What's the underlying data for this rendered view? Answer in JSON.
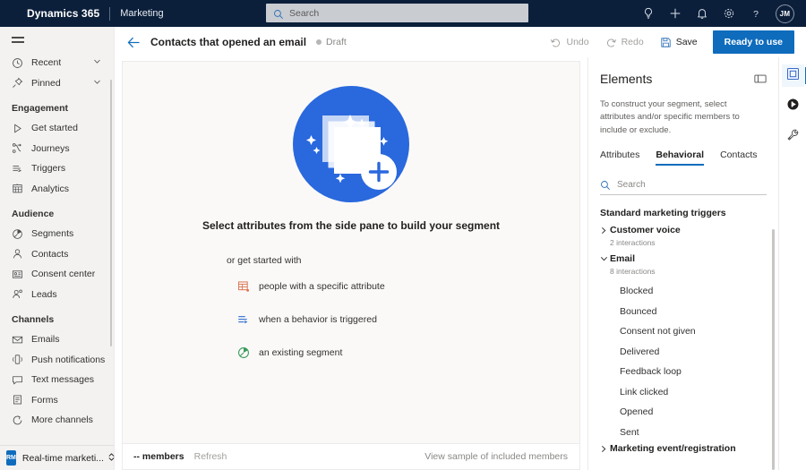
{
  "topnav": {
    "brand": "Dynamics 365",
    "app_name": "Marketing",
    "search_placeholder": "Search",
    "icons": [
      "lightbulb-icon",
      "plus-icon",
      "bell-icon",
      "gear-icon",
      "help-icon"
    ],
    "avatar_initials": "JM",
    "background": "#0b1f3b"
  },
  "sidebar": {
    "quick": [
      {
        "label": "Recent",
        "icon": "clock-icon",
        "expandable": true
      },
      {
        "label": "Pinned",
        "icon": "pin-icon",
        "expandable": true
      }
    ],
    "groups": [
      {
        "header": "Engagement",
        "items": [
          {
            "label": "Get started",
            "icon": "play-outline-icon"
          },
          {
            "label": "Journeys",
            "icon": "journeys-icon"
          },
          {
            "label": "Triggers",
            "icon": "triggers-icon"
          },
          {
            "label": "Analytics",
            "icon": "analytics-icon"
          }
        ]
      },
      {
        "header": "Audience",
        "items": [
          {
            "label": "Segments",
            "icon": "segments-icon"
          },
          {
            "label": "Contacts",
            "icon": "contact-icon"
          },
          {
            "label": "Consent center",
            "icon": "consent-icon"
          },
          {
            "label": "Leads",
            "icon": "leads-icon"
          }
        ]
      },
      {
        "header": "Channels",
        "items": [
          {
            "label": "Emails",
            "icon": "mail-icon"
          },
          {
            "label": "Push notifications",
            "icon": "push-icon"
          },
          {
            "label": "Text messages",
            "icon": "chat-icon"
          },
          {
            "label": "Forms",
            "icon": "form-icon"
          },
          {
            "label": "More channels",
            "icon": "more-channels-icon"
          }
        ]
      }
    ],
    "workspace": {
      "badge": "RM",
      "label": "Real-time marketi...",
      "badge_color": "#0f6cbd"
    }
  },
  "command_bar": {
    "back": "back-arrow-icon",
    "title": "Contacts that opened an email",
    "status": "Draft",
    "undo": "Undo",
    "redo": "Redo",
    "save": "Save",
    "primary": "Ready to use",
    "primary_color": "#0f6cbd"
  },
  "canvas": {
    "empty_title": "Select attributes from the side pane to build your segment",
    "empty_subtitle": "or get started with",
    "options": [
      {
        "label": "people with a specific attribute",
        "icon": "table-attribute-icon",
        "color": "#d9714e"
      },
      {
        "label": "when a behavior is triggered",
        "icon": "trigger-icon",
        "color": "#2f6fd0"
      },
      {
        "label": "an existing segment",
        "icon": "segment-icon",
        "color": "#3a9a5c"
      }
    ],
    "hero_icon": "stacked-cards-add-icon",
    "hero_color": "#2a68dd"
  },
  "footer": {
    "members_count": "--",
    "members_label": "members",
    "refresh": "Refresh",
    "sample_link": "View sample of included members"
  },
  "elements_panel": {
    "title": "Elements",
    "header_icon": "expand-panel-icon",
    "description": "To construct your segment, select attributes and/or specific members to include or exclude.",
    "tabs": [
      {
        "label": "Attributes",
        "active": false
      },
      {
        "label": "Behavioral",
        "active": true
      },
      {
        "label": "Contacts",
        "active": false
      }
    ],
    "search_placeholder": "Search",
    "group_header": "Standard marketing triggers",
    "nodes": [
      {
        "name": "Customer voice",
        "sub": "2 interactions",
        "expanded": false,
        "children": []
      },
      {
        "name": "Email",
        "sub": "8 interactions",
        "expanded": true,
        "children": [
          "Blocked",
          "Bounced",
          "Consent not given",
          "Delivered",
          "Feedback loop",
          "Link clicked",
          "Opened",
          "Sent"
        ]
      },
      {
        "name": "Marketing event/registration",
        "sub": "",
        "expanded": false,
        "children": []
      }
    ]
  },
  "rail": {
    "buttons": [
      {
        "icon": "elements-panel-icon",
        "active": true
      },
      {
        "icon": "insights-play-icon",
        "active": false
      },
      {
        "icon": "tools-wrench-icon",
        "active": false
      }
    ]
  }
}
